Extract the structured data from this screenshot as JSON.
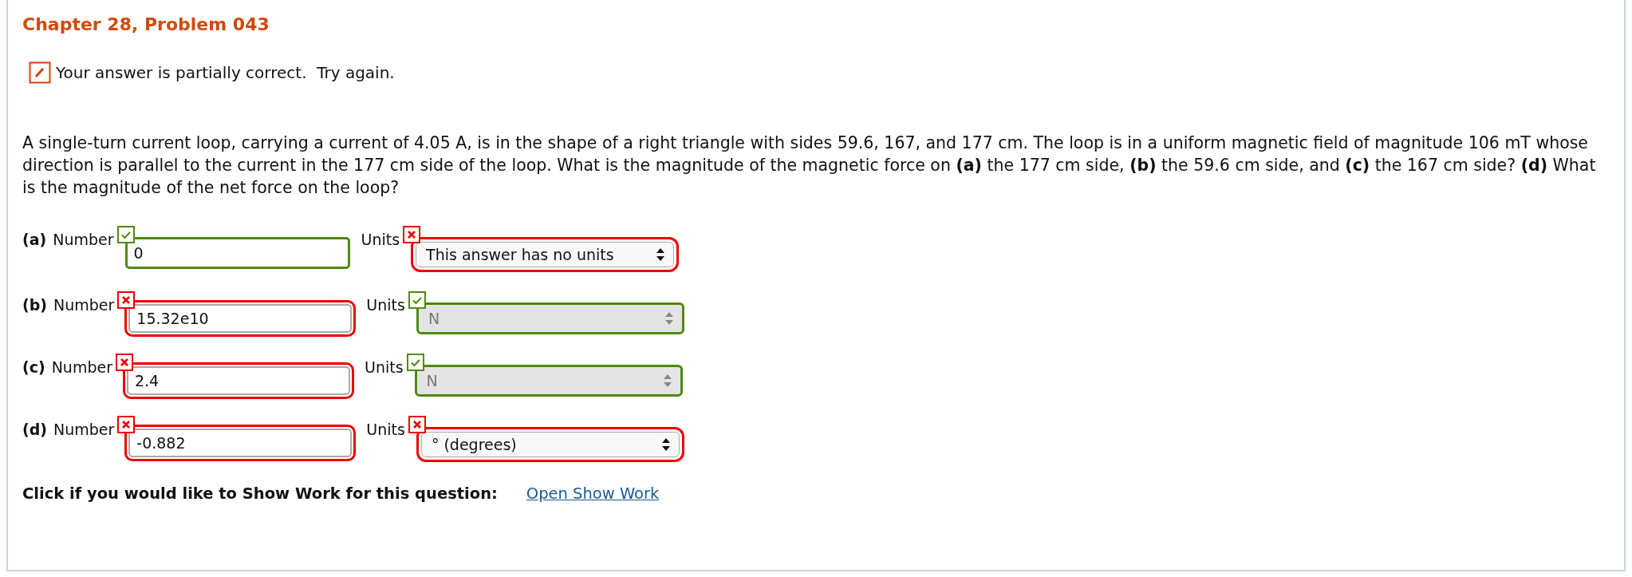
{
  "title": "Chapter 28, Problem 043",
  "feedback": {
    "text": "Your answer is partially correct.  Try again."
  },
  "problem": "A single-turn current loop, carrying a current of 4.05 A, is in the shape of a right triangle with sides 59.6, 167, and 177 cm. The loop is in a uniform magnetic field of magnitude 106 mT whose direction is parallel to the current in the 177 cm side of the loop. What is the magnitude of the magnetic force on **(a)** the 177 cm side, **(b)** the 59.6 cm side, and **(c)** the 167 cm side? **(d)** What is the magnitude of the net force on the loop?",
  "answers": [
    {
      "part": "(a)",
      "number_label": "Number",
      "value": "0",
      "number_correct": true,
      "units_label": "Units",
      "units": "This answer has no units",
      "units_correct": false,
      "units_disabled": false
    },
    {
      "part": "(b)",
      "number_label": "Number",
      "value": "15.32e10",
      "number_correct": false,
      "units_label": "Units",
      "units": "N",
      "units_correct": true,
      "units_disabled": true
    },
    {
      "part": "(c)",
      "number_label": "Number",
      "value": "2.4",
      "number_correct": false,
      "units_label": "Units",
      "units": "N",
      "units_correct": true,
      "units_disabled": true
    },
    {
      "part": "(d)",
      "number_label": "Number",
      "value": "-0.882",
      "number_correct": false,
      "units_label": "Units",
      "units": "° (degrees)",
      "units_correct": false,
      "units_disabled": false
    }
  ],
  "show_work": {
    "prompt": "Click if you would like to Show Work for this question:",
    "link": "Open Show Work"
  }
}
